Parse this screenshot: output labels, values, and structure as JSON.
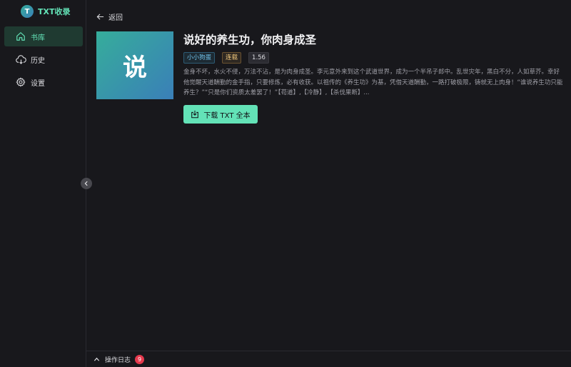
{
  "app": {
    "logo_letter": "T",
    "title": "TXT收录"
  },
  "sidebar": {
    "items": [
      {
        "label": "书库",
        "icon": "home-icon",
        "active": true
      },
      {
        "label": "历史",
        "icon": "cloud-icon",
        "active": false
      },
      {
        "label": "设置",
        "icon": "gear-icon",
        "active": false
      }
    ]
  },
  "header": {
    "back_label": "返回"
  },
  "book": {
    "cover_char": "说",
    "title": "说好的养生功，你肉身成圣",
    "author": "小小狗蛋",
    "status": "连载",
    "version": "1.56",
    "description": "金身不坏，水火不侵，万法不沾，是为肉身成圣。李元意外来到这个武道世界，成为一个半吊子郎中。乱世灾年，黑白不分，人如草芥。幸好他觉醒天道酬勤的金手指，只要修炼，必有收获。以祖传的《养生功》为基，凭借天道酬勤，一路打破极限，铸就无上肉身！“谁说养生功只能养生？”“只是你们资质太差罢了！”【苟道】,【冷静】,【杀伐果断】..."
  },
  "actions": {
    "download_label": "下载 TXT 全本"
  },
  "log": {
    "label": "操作日志",
    "count": "9"
  },
  "colors": {
    "accent": "#63e2b7",
    "background": "#18181c",
    "badge": "#e5394d"
  }
}
